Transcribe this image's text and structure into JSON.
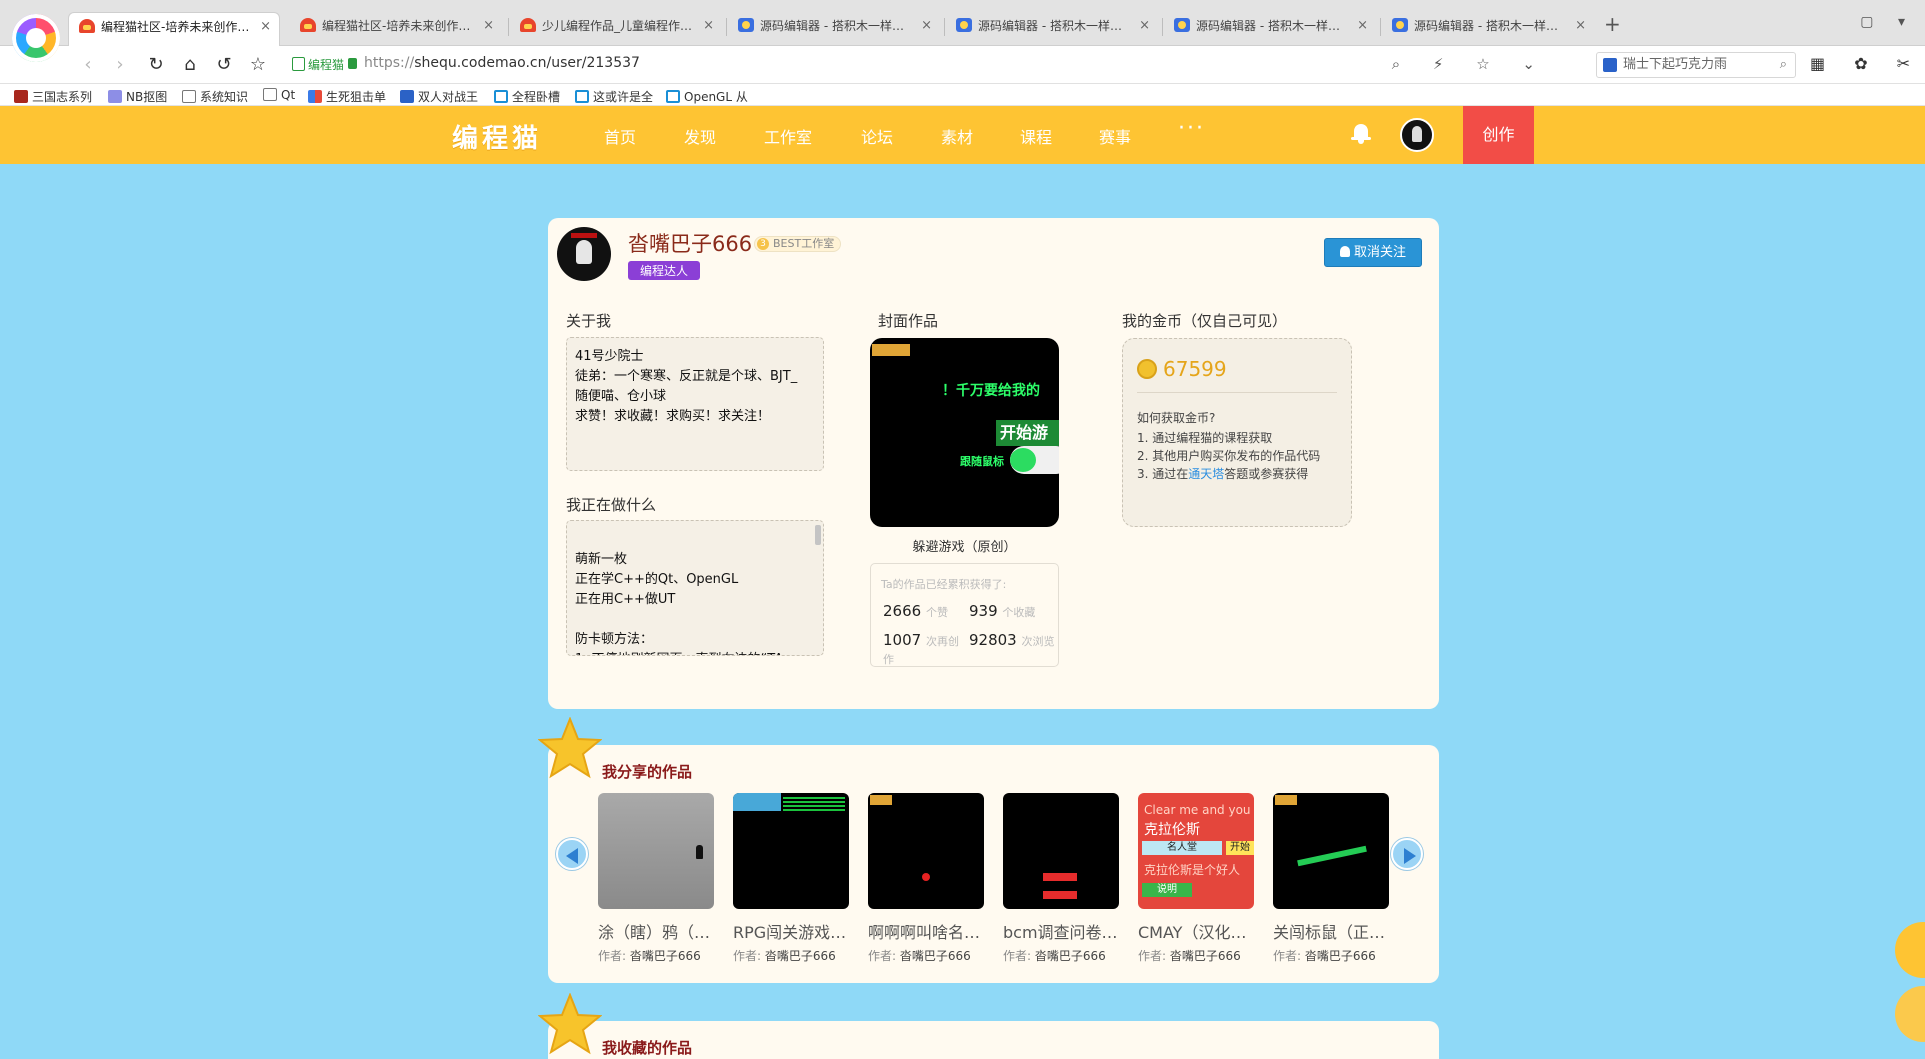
{
  "browser": {
    "tabs": [
      {
        "title": "编程猫社区-培养未来创作者 -",
        "icon": "cat-favicon",
        "active": true
      },
      {
        "title": "编程猫社区-培养未来创作者 -",
        "icon": "cat-favicon",
        "active": false
      },
      {
        "title": "少儿编程作品_儿童编程作品_s",
        "icon": "cat-favicon",
        "active": false
      },
      {
        "title": "源码编辑器 - 搭积木一样有趣",
        "icon": "code-favicon",
        "active": false
      },
      {
        "title": "源码编辑器 - 搭积木一样有趣",
        "icon": "code-favicon",
        "active": false
      },
      {
        "title": "源码编辑器 - 搭积木一样有趣",
        "icon": "code-favicon",
        "active": false
      },
      {
        "title": "源码编辑器 - 搭积木一样有趣",
        "icon": "code-favicon",
        "active": false
      }
    ],
    "tab_close": "×",
    "new_tab": "+",
    "address": {
      "secure_label": "编程猫",
      "protocol": "https://",
      "url": "shequ.codemao.cn/user/213537"
    },
    "search_placeholder": "瑞士下起巧克力雨",
    "bookmarks": [
      {
        "label": "三国志系列",
        "icon": "red"
      },
      {
        "label": "NB抠图",
        "icon": "photo"
      },
      {
        "label": "系统知识",
        "icon": "folder"
      },
      {
        "label": "Qt",
        "icon": "folder"
      },
      {
        "label": "生死狙击单",
        "icon": "grid"
      },
      {
        "label": "双人对战王",
        "icon": "blue"
      },
      {
        "label": "全程卧槽",
        "icon": "tv"
      },
      {
        "label": "这或许是全",
        "icon": "tv"
      },
      {
        "label": "OpenGL 从",
        "icon": "tv"
      }
    ]
  },
  "site": {
    "logo": "编程猫",
    "nav": [
      "首页",
      "发现",
      "工作室",
      "论坛",
      "素材",
      "课程",
      "赛事"
    ],
    "more": "···",
    "create_label": "创作"
  },
  "profile": {
    "name": "沓嘴巴子666",
    "studio": "BEST工作室",
    "badge": "编程达人",
    "unfollow_label": "取消关注",
    "about_title": "关于我",
    "about_text": "41号少院士\n徒弟：一个寒寒、反正就是个球、BJT_\n随便喵、仓小球\n求赞！求收藏！求购买！求关注！",
    "doing_title": "我正在做什么",
    "doing_text": "萌新一枚\n正在学C++的Qt、OpenGL\n正在用C++做UT\n\n防卡顿方法：\n1. 不停地刷新网页，直到右边的“TA",
    "cover_title": "封面作品",
    "cover_game": {
      "line1": "！千万要给我的",
      "start": "开始游",
      "mode": "跟随鼠标"
    },
    "cover_caption": "躲避游戏（原创）",
    "stats_head": "Ta的作品已经累积获得了:",
    "stats": {
      "likes": "2666",
      "likes_unit": "个赞",
      "collects": "939",
      "collects_unit": "个收藏",
      "recreates": "1007",
      "recreates_unit": "次再创作",
      "views": "92803",
      "views_unit": "次浏览"
    },
    "coins_title": "我的金币（仅自己可见）",
    "coins_value": "67599",
    "coins_question": "如何获取金币?",
    "coins_tips": [
      {
        "pre": "1. 通过编程猫的课程获取",
        "link": "",
        "post": ""
      },
      {
        "pre": "2. 其他用户购买你发布的作品代码",
        "link": "",
        "post": ""
      },
      {
        "pre": "3. 通过在",
        "link": "通天塔",
        "post": "答题或参赛获得"
      }
    ]
  },
  "shared_works": {
    "title": "我分享的作品",
    "author_prefix": "作者:",
    "items": [
      {
        "title": "涂（瞎）鸦（…",
        "author": "沓嘴巴子666"
      },
      {
        "title": "RPG闯关游戏…",
        "author": "沓嘴巴子666"
      },
      {
        "title": "啊啊啊叫啥名…",
        "author": "沓嘴巴子666"
      },
      {
        "title": "bcm调查问卷…",
        "author": "沓嘴巴子666"
      },
      {
        "title": "CMAY（汉化…",
        "author": "沓嘴巴子666"
      },
      {
        "title": "关闯标鼠（正…",
        "author": "沓嘴巴子666"
      }
    ],
    "cmay_thumb": {
      "line1": "Clear me and you",
      "line2": "克拉伦斯",
      "hall": "名人堂",
      "start": "开始",
      "line3": "克拉伦斯是个好人",
      "help": "说明"
    }
  },
  "collected_works": {
    "title": "我收藏的作品"
  },
  "colors": {
    "header": "#fec433",
    "page_bg": "#8fd9f7",
    "create": "#f24d47"
  }
}
